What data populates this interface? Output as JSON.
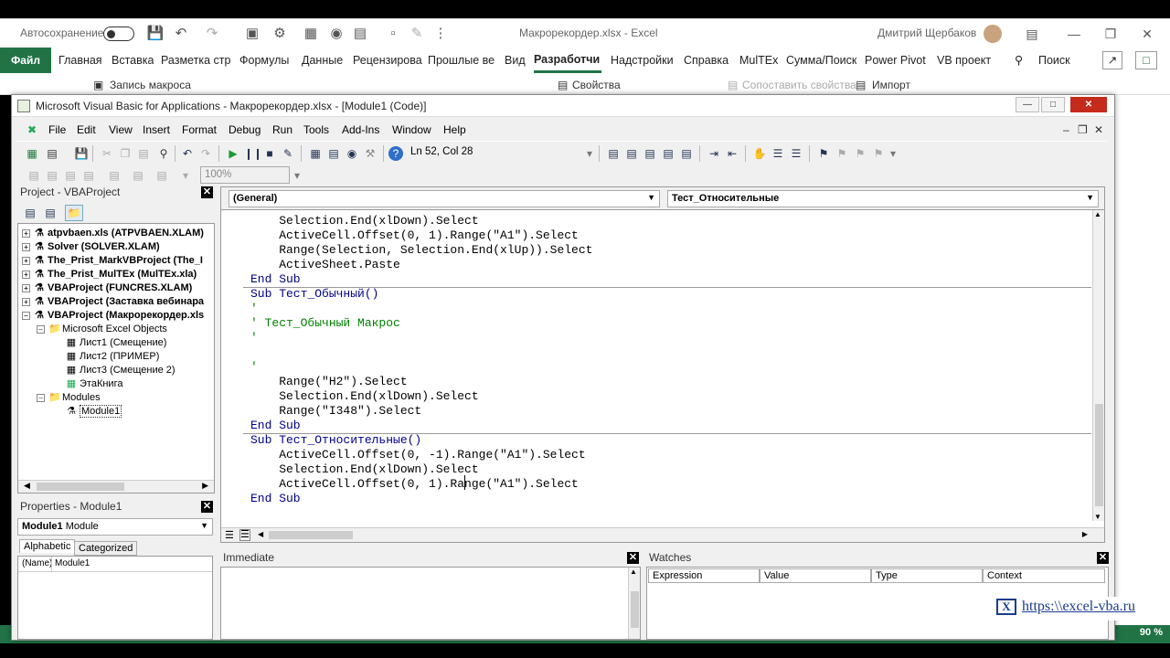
{
  "excel": {
    "autosave_label": "Автосохранение",
    "file_name": "Макрорекордер.xlsx  -  Excel",
    "user_name": "Дмитрий Щербаков",
    "tabs": [
      "Файл",
      "Главная",
      "Вставка",
      "Разметка стр",
      "Формулы",
      "Данные",
      "Рецензирова",
      "Прошлые ве",
      "Вид",
      "Разработчи",
      "Надстройки",
      "Справка",
      "MulTEx",
      "Сумма/Поиск",
      "Power Pivot",
      "VB проект"
    ],
    "search_label": "Поиск",
    "ribbon": {
      "record_macro": "Запись макроса",
      "properties": "Свойства",
      "compare_props": "Сопоставить свойства",
      "import": "Импорт"
    },
    "zoom": "90 %"
  },
  "vbe": {
    "title": "Microsoft Visual Basic for Applications - Макрорекордер.xlsx - [Module1 (Code)]",
    "menu": [
      "File",
      "Edit",
      "View",
      "Insert",
      "Format",
      "Debug",
      "Run",
      "Tools",
      "Add-Ins",
      "Window",
      "Help"
    ],
    "position": "Ln 52, Col 28",
    "zoom": "100%",
    "project": {
      "title": "Project - VBAProject",
      "nodes": [
        {
          "label": "atpvbaen.xls (ATPVBAEN.XLAM)",
          "bold": true
        },
        {
          "label": "Solver (SOLVER.XLAM)",
          "bold": true
        },
        {
          "label": "The_Prist_MarkVBProject (The_I",
          "bold": true
        },
        {
          "label": "The_Prist_MulTEx (MulTEx.xla)",
          "bold": true
        },
        {
          "label": "VBAProject (FUNCRES.XLAM)",
          "bold": true
        },
        {
          "label": "VBAProject (Заставка вебинара",
          "bold": true
        },
        {
          "label": "VBAProject (Макрорекордер.xls",
          "bold": true
        },
        {
          "label": "Microsoft Excel Objects",
          "bold": false
        },
        {
          "label": "Лист1 (Смещение)",
          "bold": false
        },
        {
          "label": "Лист2 (ПРИМЕР)",
          "bold": false
        },
        {
          "label": "Лист3 (Смещение 2)",
          "bold": false
        },
        {
          "label": "ЭтаКнига",
          "bold": false
        },
        {
          "label": "Modules",
          "bold": false
        },
        {
          "label": "Module1",
          "bold": false
        }
      ]
    },
    "properties": {
      "title": "Properties - Module1",
      "object_name": "Module1",
      "object_type": "Module",
      "tab_alpha": "Alphabetic",
      "tab_cat": "Categorized",
      "row_name": "(Name)",
      "row_value": "Module1"
    },
    "code": {
      "object_combo": "(General)",
      "proc_combo": "Тест_Относительные",
      "lines": [
        {
          "t": "    Selection.End(xlDown).Select",
          "k": "n"
        },
        {
          "t": "    ActiveCell.Offset(0, 1).Range(\"A1\").Select",
          "k": "n"
        },
        {
          "t": "    Range(Selection, Selection.End(xlUp)).Select",
          "k": "n"
        },
        {
          "t": "    ActiveSheet.Paste",
          "k": "n"
        },
        {
          "t": "End Sub",
          "k": "kw"
        },
        {
          "t": "Sub Тест_Обычный()",
          "k": "kw"
        },
        {
          "t": "'",
          "k": "cm"
        },
        {
          "t": "' Тест_Обычный Макрос",
          "k": "cm"
        },
        {
          "t": "'",
          "k": "cm"
        },
        {
          "t": "",
          "k": "n"
        },
        {
          "t": "'",
          "k": "cm"
        },
        {
          "t": "    Range(\"H2\").Select",
          "k": "n"
        },
        {
          "t": "    Selection.End(xlDown).Select",
          "k": "n"
        },
        {
          "t": "    Range(\"I348\").Select",
          "k": "n"
        },
        {
          "t": "End Sub",
          "k": "kw"
        },
        {
          "t": "Sub Тест_Относительные()",
          "k": "kw"
        },
        {
          "t": "    ActiveCell.Offset(0, -1).Range(\"A1\").Select",
          "k": "n"
        },
        {
          "t": "    Selection.End(xlDown).Select",
          "k": "n"
        },
        {
          "t": "    ActiveCell.Offset(0, 1).Range(\"A1\").Select",
          "k": "n"
        },
        {
          "t": "End Sub",
          "k": "kw"
        }
      ]
    },
    "immediate_title": "Immediate",
    "watches": {
      "title": "Watches",
      "columns": [
        "Expression",
        "Value",
        "Type",
        "Context"
      ]
    }
  },
  "watermark": "https:\\\\excel-vba.ru"
}
